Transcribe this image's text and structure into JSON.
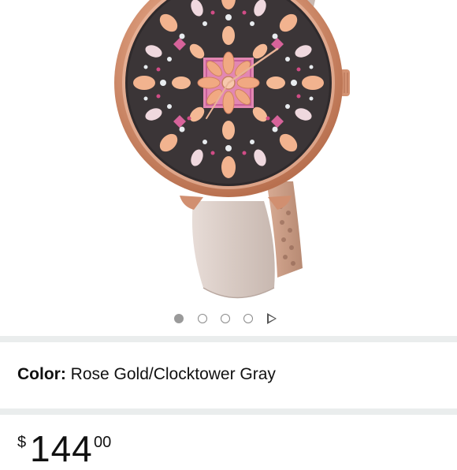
{
  "product": {
    "image_alt": "Rose gold watch with mosaic dial and gray leather strap",
    "color_label": "Color:",
    "color_value": "Rose Gold/Clocktower Gray",
    "price": {
      "symbol": "$",
      "whole": "144",
      "fraction": "00"
    }
  },
  "carousel": {
    "total_images": 4,
    "active_index": 0,
    "has_video": true
  },
  "colors": {
    "separator": "#eaeded",
    "rose_gold": "#d9987a",
    "dial_dark": "#3a3436",
    "dial_pink": "#e07aa8",
    "strap_gray": "#d9ccc6"
  }
}
